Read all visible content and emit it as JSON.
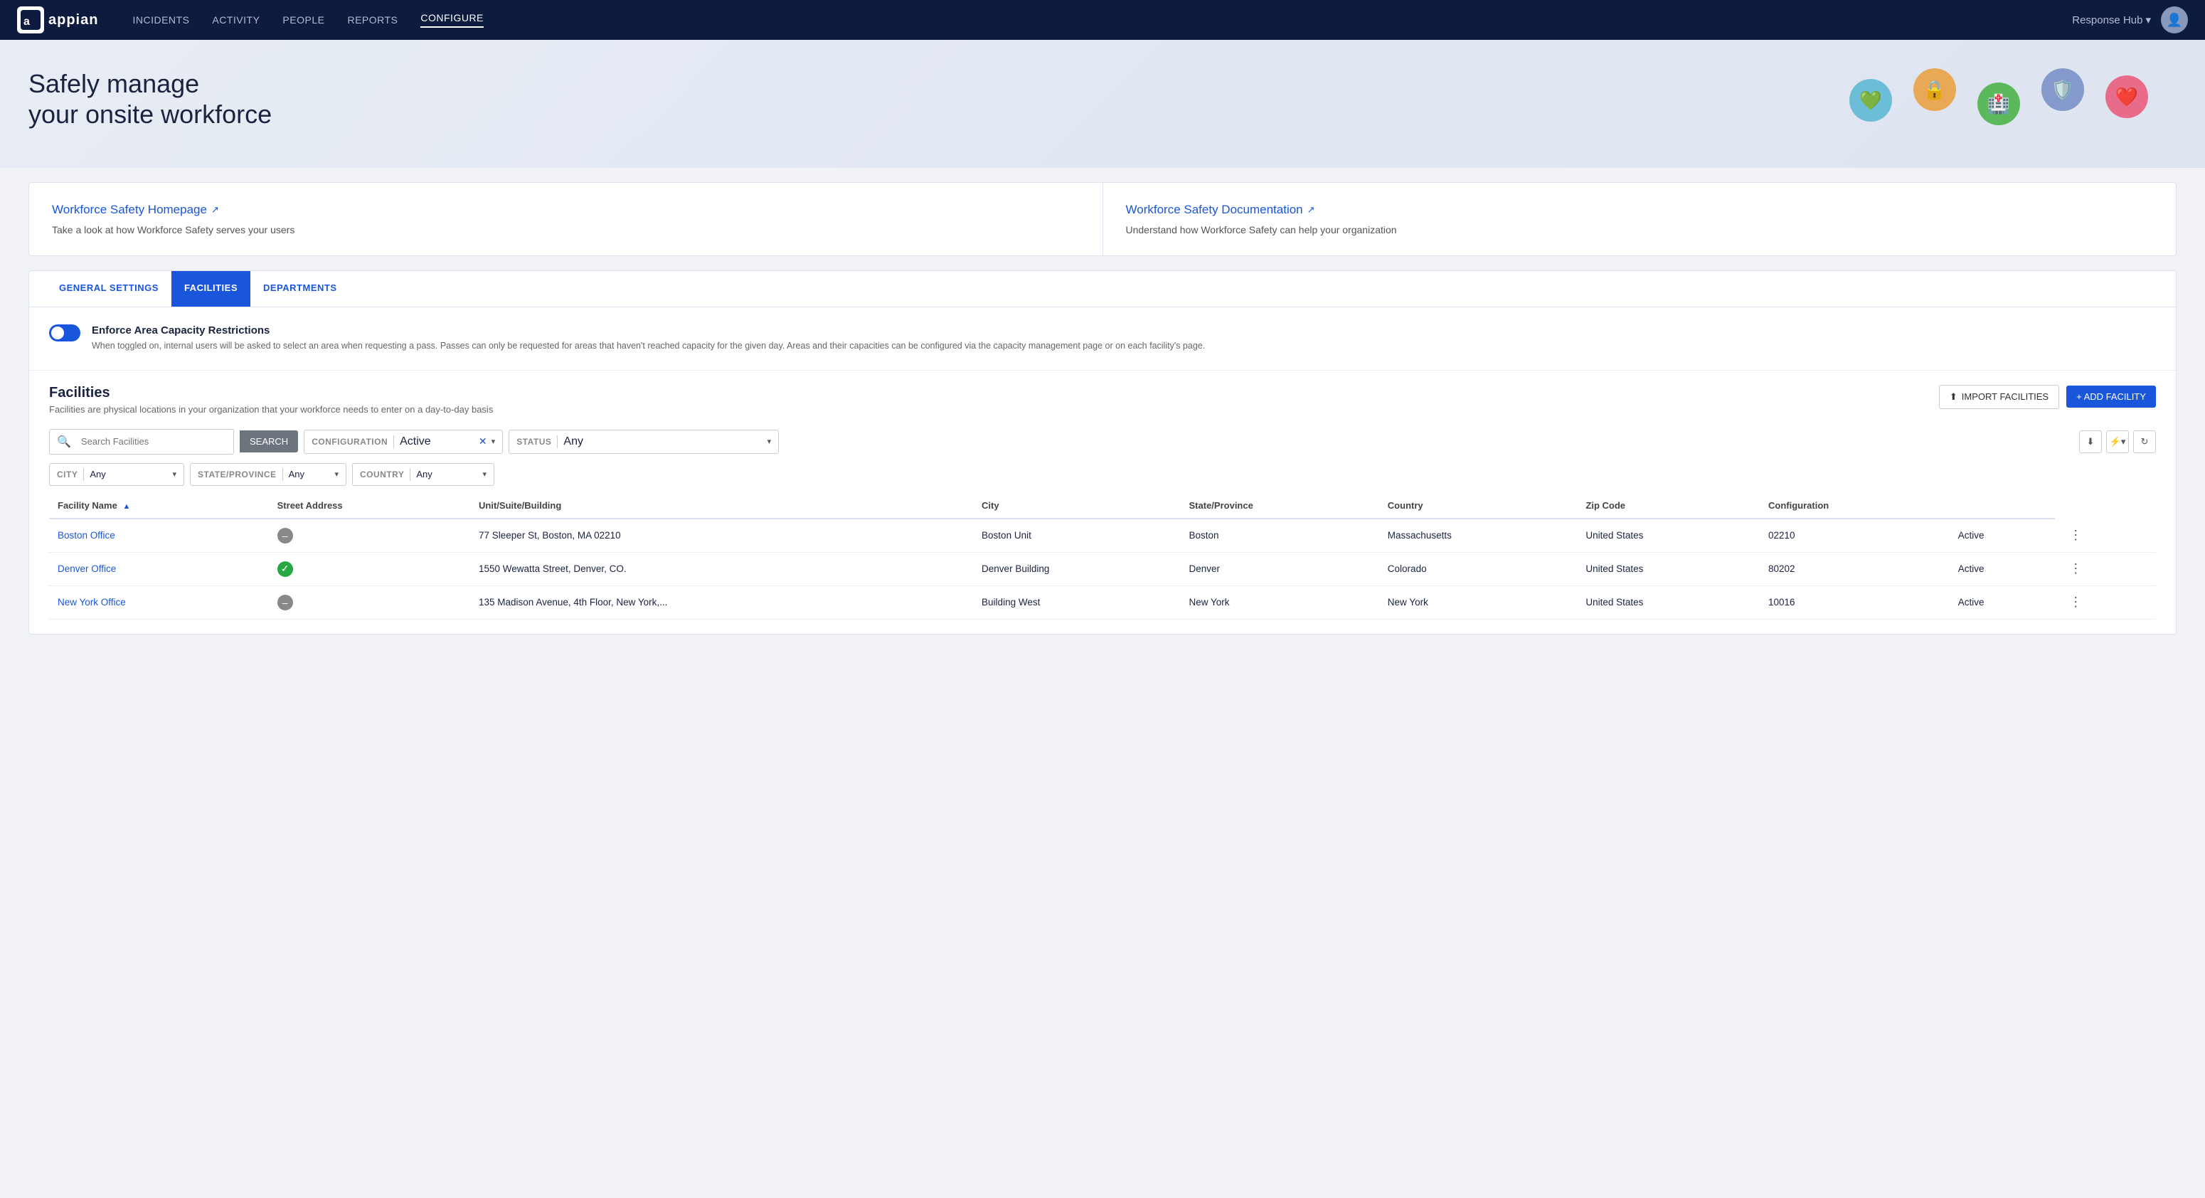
{
  "nav": {
    "logo_text": "appian",
    "links": [
      {
        "label": "INCIDENTS",
        "active": false
      },
      {
        "label": "ACTIVITY",
        "active": false
      },
      {
        "label": "PEOPLE",
        "active": false
      },
      {
        "label": "REPORTS",
        "active": false
      },
      {
        "label": "CONFIGURE",
        "active": true
      }
    ],
    "hub_label": "Response Hub",
    "hub_caret": "▾"
  },
  "hero": {
    "title_line1": "Safely manage",
    "title_line2": "your onsite workforce"
  },
  "cards": [
    {
      "link_label": "Workforce Safety Homepage",
      "link_icon": "↗",
      "description": "Take a look at how Workforce Safety serves your users"
    },
    {
      "link_label": "Workforce Safety Documentation",
      "link_icon": "↗",
      "description": "Understand how Workforce Safety can help your organization"
    }
  ],
  "tabs": [
    {
      "label": "GENERAL SETTINGS",
      "active": false
    },
    {
      "label": "FACILITIES",
      "active": true
    },
    {
      "label": "DEPARTMENTS",
      "active": false
    }
  ],
  "toggle": {
    "title": "Enforce Area Capacity Restrictions",
    "description": "When toggled on, internal users will be asked to select an area when requesting a pass. Passes can only be requested for areas that haven't reached capacity for the given day. Areas and their capacities can be configured via the capacity management page or on each facility's page."
  },
  "facilities": {
    "section_title": "Facilities",
    "section_desc": "Facilities are physical locations in your organization that your workforce needs to enter on a day-to-day basis",
    "btn_import": "IMPORT FACILITIES",
    "btn_add": "+ ADD FACILITY",
    "search_placeholder": "Search Facilities",
    "search_btn": "SEARCH",
    "filter_config_label": "CONFIGURATION",
    "filter_config_value": "Active",
    "filter_status_label": "STATUS",
    "filter_status_value": "Any",
    "filter_city_label": "CITY",
    "filter_city_value": "Any",
    "filter_state_label": "STATE/PROVINCE",
    "filter_state_value": "Any",
    "filter_country_label": "COUNTRY",
    "filter_country_value": "Any",
    "columns": [
      {
        "label": "Facility Name",
        "sortable": true
      },
      {
        "label": "Street Address",
        "sortable": false
      },
      {
        "label": "Unit/Suite/Building",
        "sortable": false
      },
      {
        "label": "City",
        "sortable": false
      },
      {
        "label": "State/Province",
        "sortable": false
      },
      {
        "label": "Country",
        "sortable": false
      },
      {
        "label": "Zip Code",
        "sortable": false
      },
      {
        "label": "Configuration",
        "sortable": false
      }
    ],
    "rows": [
      {
        "name": "Boston Office",
        "status": "minus",
        "address": "77 Sleeper St, Boston, MA 02210",
        "unit": "Boston Unit",
        "city": "Boston",
        "state": "Massachusetts",
        "country": "United States",
        "zip": "02210",
        "config": "Active"
      },
      {
        "name": "Denver Office",
        "status": "check",
        "address": "1550 Wewatta Street, Denver, CO.",
        "unit": "Denver Building",
        "city": "Denver",
        "state": "Colorado",
        "country": "United States",
        "zip": "80202",
        "config": "Active"
      },
      {
        "name": "New York Office",
        "status": "minus",
        "address": "135 Madison Avenue, 4th Floor, New York,...",
        "unit": "Building West",
        "city": "New York",
        "state": "New York",
        "country": "United States",
        "zip": "10016",
        "config": "Active"
      }
    ]
  }
}
